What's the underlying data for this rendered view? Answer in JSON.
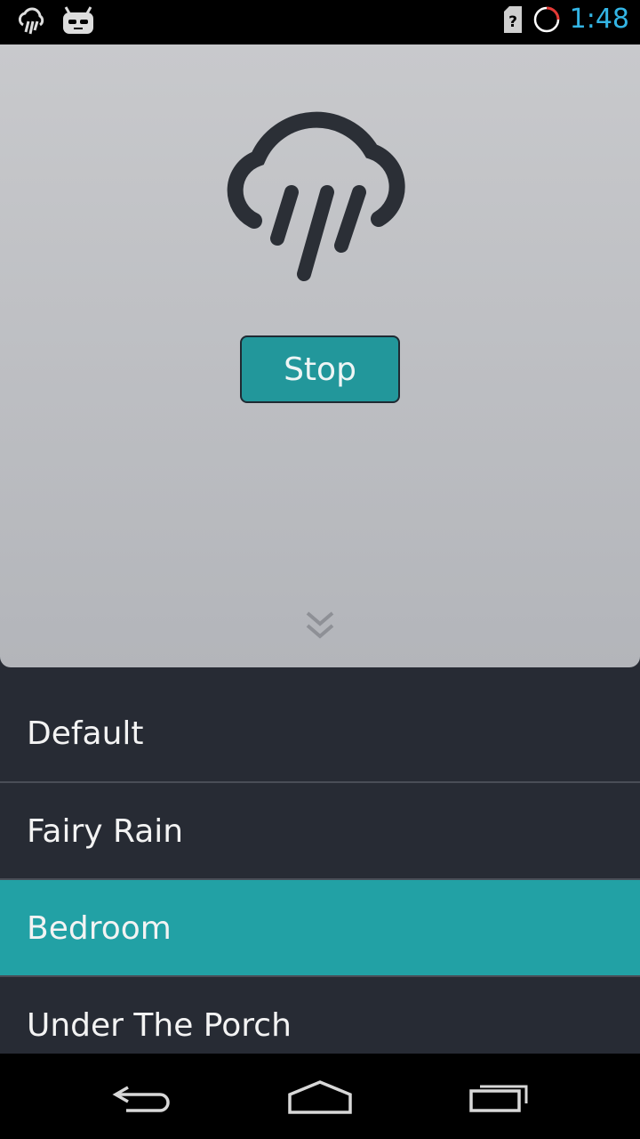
{
  "status_bar": {
    "time": "1:48",
    "left_icons": [
      "rain-cloud-icon",
      "cyanogen-mod-icon"
    ],
    "right_icons": [
      "no-sim-icon",
      "loading-circle-icon"
    ]
  },
  "player": {
    "stop_label": "Stop",
    "icon": "rain-cloud-icon",
    "expand_icon": "double-chevron-down-icon"
  },
  "presets": [
    {
      "label": "Default",
      "selected": false
    },
    {
      "label": "Fairy Rain",
      "selected": false
    },
    {
      "label": "Bedroom",
      "selected": true
    },
    {
      "label": "Under The Porch",
      "selected": false
    }
  ],
  "nav_bar": {
    "icons": [
      "back-icon",
      "home-icon",
      "recent-apps-icon"
    ]
  },
  "colors": {
    "accent": "#22a1a5",
    "list_background": "#272b34",
    "panel_background": "#c1c2c5",
    "time_color": "#33b5e5"
  }
}
